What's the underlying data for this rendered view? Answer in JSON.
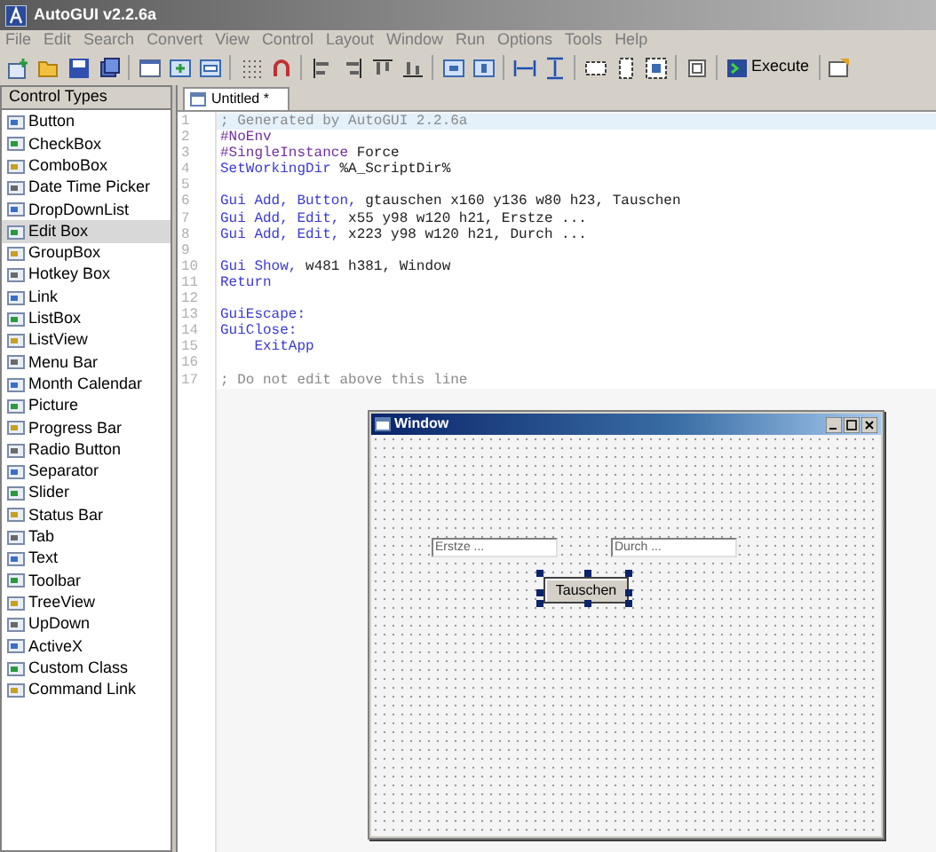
{
  "window": {
    "title": "AutoGUI v2.2.6a"
  },
  "menu": [
    "File",
    "Edit",
    "Search",
    "Convert",
    "View",
    "Control",
    "Layout",
    "Window",
    "Run",
    "Options",
    "Tools",
    "Help"
  ],
  "toolbar": {
    "execute_label": "Execute"
  },
  "sidebar": {
    "title": "Control Types",
    "items": [
      {
        "label": "Button",
        "selected": false
      },
      {
        "label": "CheckBox",
        "selected": false
      },
      {
        "label": "ComboBox",
        "selected": false
      },
      {
        "label": "Date Time Picker",
        "selected": false
      },
      {
        "label": "DropDownList",
        "selected": false
      },
      {
        "label": "Edit Box",
        "selected": true
      },
      {
        "label": "GroupBox",
        "selected": false
      },
      {
        "label": "Hotkey Box",
        "selected": false
      },
      {
        "label": "Link",
        "selected": false
      },
      {
        "label": "ListBox",
        "selected": false
      },
      {
        "label": "ListView",
        "selected": false
      },
      {
        "label": "Menu Bar",
        "selected": false
      },
      {
        "label": "Month Calendar",
        "selected": false
      },
      {
        "label": "Picture",
        "selected": false
      },
      {
        "label": "Progress Bar",
        "selected": false
      },
      {
        "label": "Radio Button",
        "selected": false
      },
      {
        "label": "Separator",
        "selected": false
      },
      {
        "label": "Slider",
        "selected": false
      },
      {
        "label": "Status Bar",
        "selected": false
      },
      {
        "label": "Tab",
        "selected": false
      },
      {
        "label": "Text",
        "selected": false
      },
      {
        "label": "Toolbar",
        "selected": false
      },
      {
        "label": "TreeView",
        "selected": false
      },
      {
        "label": "UpDown",
        "selected": false
      },
      {
        "label": "ActiveX",
        "selected": false
      },
      {
        "label": "Custom Class",
        "selected": false
      },
      {
        "label": "Command Link",
        "selected": false
      }
    ]
  },
  "tabs": [
    {
      "label": "Untitled *",
      "selected": true
    }
  ],
  "editor": {
    "lines": [
      {
        "number": "1",
        "current": true,
        "tokens": [
          {
            "text": "; Generated by AutoGUI 2.2.6a",
            "kind": "comment"
          }
        ]
      },
      {
        "number": "2",
        "current": false,
        "tokens": [
          {
            "text": "#NoEnv",
            "kind": "directive"
          }
        ]
      },
      {
        "number": "3",
        "current": false,
        "tokens": [
          {
            "text": "#SingleInstance",
            "kind": "directive"
          },
          {
            "text": " Force",
            "kind": "plain"
          }
        ]
      },
      {
        "number": "4",
        "current": false,
        "tokens": [
          {
            "text": "SetWorkingDir",
            "kind": "command"
          },
          {
            "text": " %A_ScriptDir%",
            "kind": "plain"
          }
        ]
      },
      {
        "number": "5",
        "current": false
      },
      {
        "number": "6",
        "current": false,
        "tokens": [
          {
            "text": "Gui Add, Button,",
            "kind": "command"
          },
          {
            "text": " gtauschen x160 y136 w80 h23, Tauschen",
            "kind": "plain"
          }
        ]
      },
      {
        "number": "7",
        "current": false,
        "tokens": [
          {
            "text": "Gui Add, Edit,",
            "kind": "command"
          },
          {
            "text": " x55 y98 w120 h21, Erstze ...",
            "kind": "plain"
          }
        ]
      },
      {
        "number": "8",
        "current": false,
        "tokens": [
          {
            "text": "Gui Add, Edit,",
            "kind": "command"
          },
          {
            "text": " x223 y98 w120 h21, Durch ...",
            "kind": "plain"
          }
        ]
      },
      {
        "number": "9",
        "current": false
      },
      {
        "number": "10",
        "current": false,
        "tokens": [
          {
            "text": "Gui Show,",
            "kind": "command"
          },
          {
            "text": " w481 h381, Window",
            "kind": "plain"
          }
        ]
      },
      {
        "number": "11",
        "current": false,
        "tokens": [
          {
            "text": "Return",
            "kind": "command"
          }
        ]
      },
      {
        "number": "12",
        "current": false
      },
      {
        "number": "13",
        "current": false,
        "tokens": [
          {
            "text": "GuiEscape:",
            "kind": "command"
          }
        ]
      },
      {
        "number": "14",
        "current": false,
        "tokens": [
          {
            "text": "GuiClose:",
            "kind": "command"
          }
        ]
      },
      {
        "number": "15",
        "current": false,
        "tokens": [
          {
            "text": "    ExitApp",
            "kind": "command"
          }
        ]
      },
      {
        "number": "16",
        "current": false
      },
      {
        "number": "17",
        "current": false,
        "tokens": [
          {
            "text": "; Do not edit above this line",
            "kind": "comment"
          }
        ]
      }
    ]
  },
  "design_window": {
    "title": "Window",
    "controls": [
      {
        "kind": "edit",
        "text": "Erstze ...",
        "selected": false
      },
      {
        "kind": "edit",
        "text": "Durch ...",
        "selected": false
      },
      {
        "kind": "button",
        "text": "Tauschen",
        "selected": true
      }
    ]
  }
}
